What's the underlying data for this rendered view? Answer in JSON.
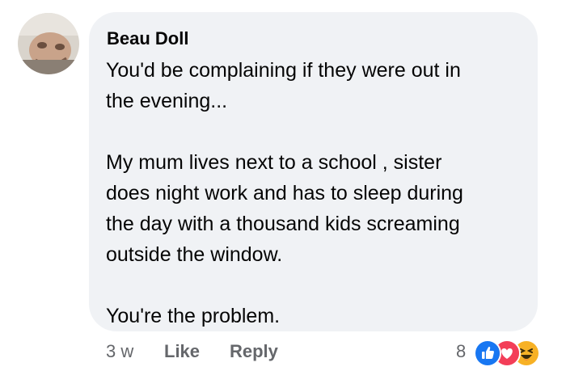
{
  "comment": {
    "author": "Beau Doll",
    "lines": [
      "You'd be complaining if they were out in",
      "the evening...",
      "",
      "My mum lives next to a school , sister",
      "does night work and has to sleep during",
      "the day with a thousand kids screaming",
      "outside the window.",
      "",
      "You're the problem."
    ],
    "time": "3 w",
    "like_label": "Like",
    "reply_label": "Reply",
    "reaction_count": "8",
    "reactions": [
      "like-icon",
      "love-icon",
      "haha-icon"
    ]
  },
  "colors": {
    "bubble": "#f0f2f5",
    "text": "#050505",
    "meta": "#65676b",
    "like_blue": "#1877f2",
    "love_red": "#f33e58",
    "haha_yellow": "#f7b125"
  }
}
